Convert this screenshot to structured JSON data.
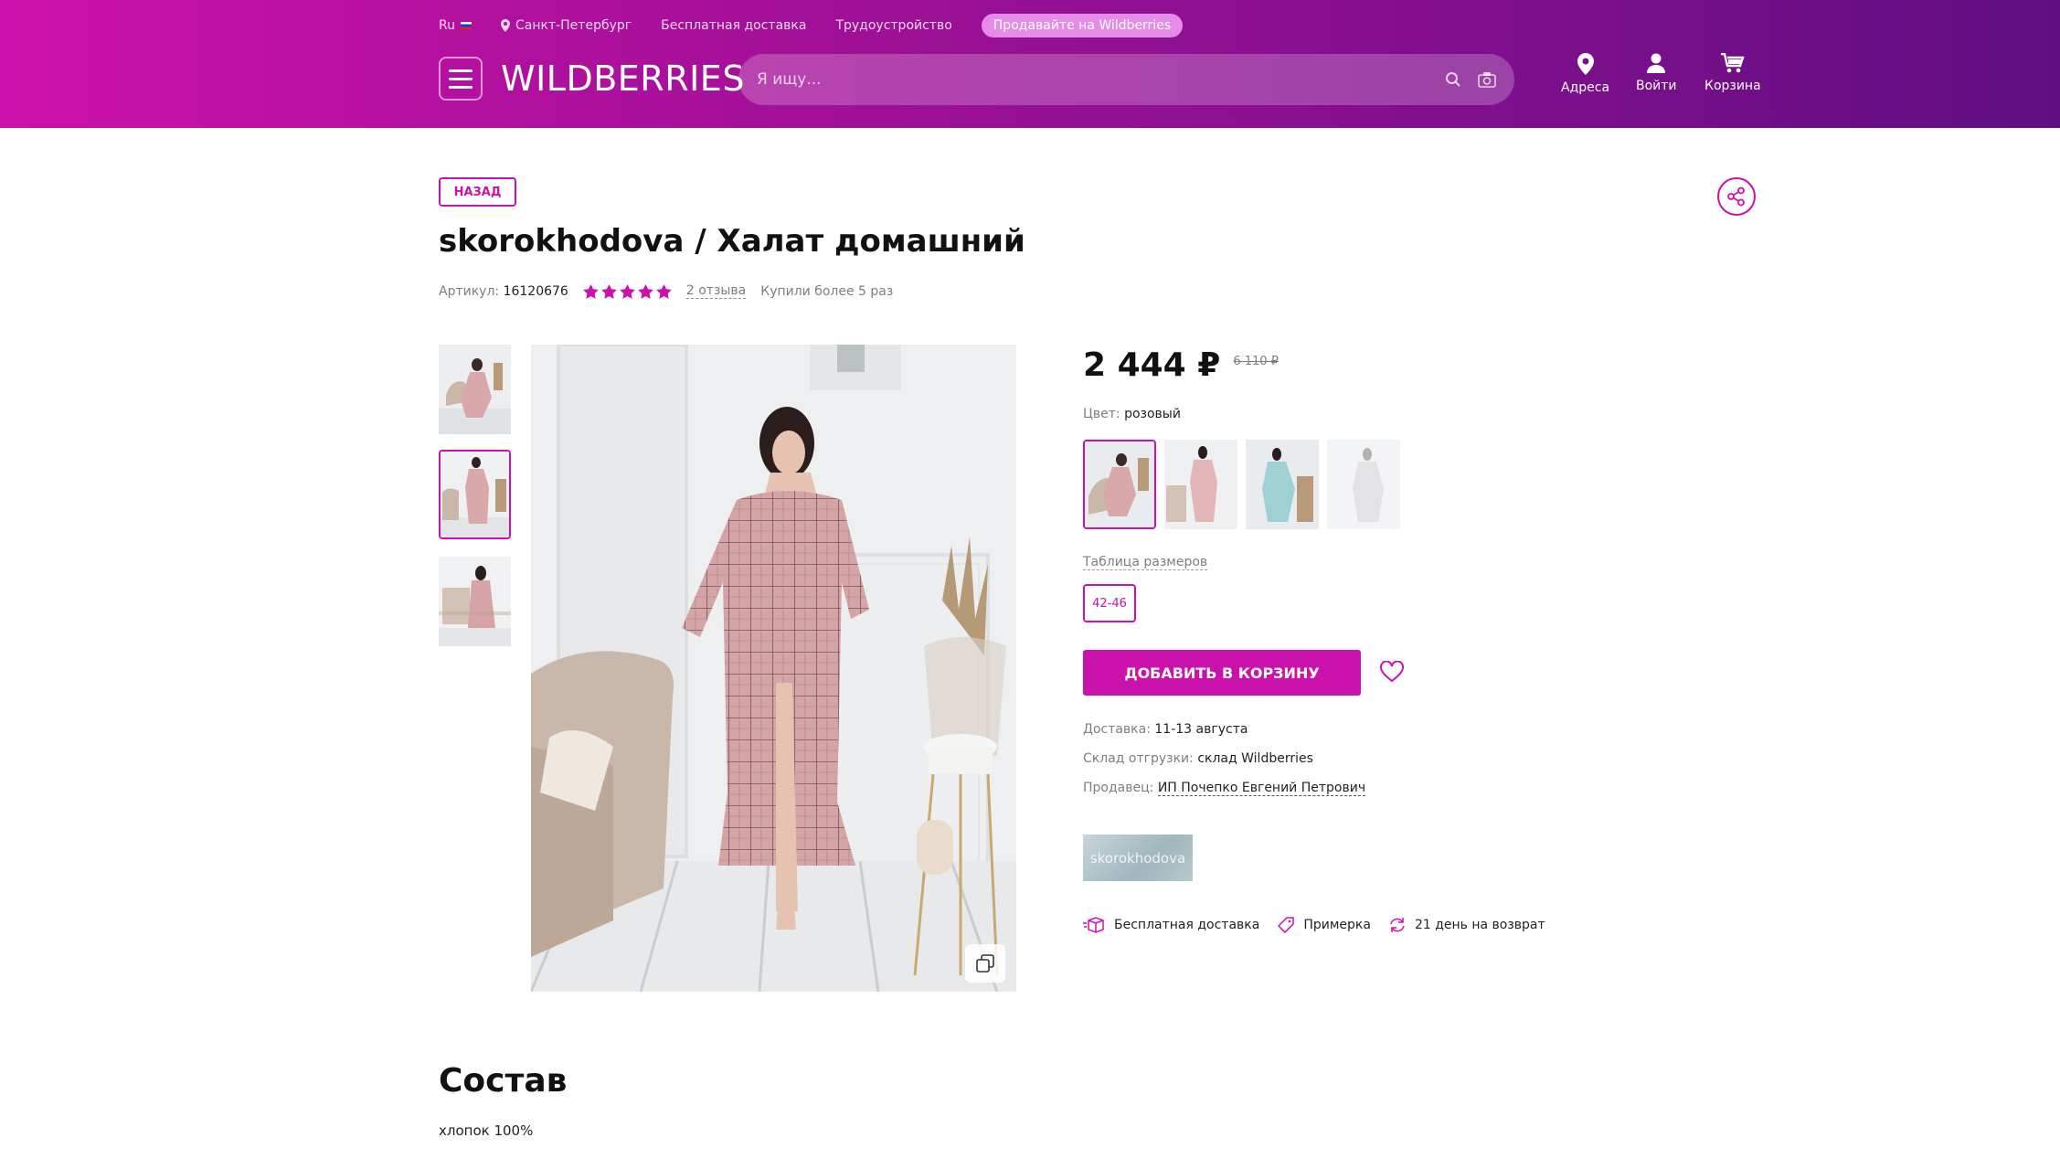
{
  "header": {
    "lang": "Ru",
    "city": "Санкт-Петербург",
    "free_delivery": "Бесплатная доставка",
    "jobs": "Трудоустройство",
    "sell": "Продавайте на Wildberries",
    "logo": "WILDBERRIES",
    "search_placeholder": "Я ищу...",
    "addresses": "Адреса",
    "login": "Войти",
    "cart": "Корзина"
  },
  "product": {
    "back": "НАЗАД",
    "title": "skorokhodova / Халат домашний",
    "article_label": "Артикул:",
    "article": "16120676",
    "rating": 5,
    "reviews": "2 отзыва",
    "bought": "Купили более 5 раз",
    "price": "2 444 ₽",
    "old_price": "6 110 ₽",
    "color_label": "Цвет:",
    "color": "розовый",
    "size_table": "Таблица размеров",
    "size": "42-46",
    "add_to_cart": "ДОБАВИТЬ В КОРЗИНУ",
    "delivery_label": "Доставка:",
    "delivery": "11-13 августа",
    "warehouse_label": "Склад отгрузки:",
    "warehouse": "склад Wildberries",
    "seller_label": "Продавец:",
    "seller": "ИП Почепко Евгений Петрович",
    "brand_logo": "skorokhodova",
    "features": [
      "Бесплатная доставка",
      "Примерка",
      "21 день на возврат"
    ]
  },
  "composition": {
    "title": "Состав",
    "text": "хлопок 100%"
  },
  "colors": {
    "accent": "#cb11ab",
    "robe_pink": "#d9a8aa",
    "robe_blue": "#9fd0d4"
  }
}
